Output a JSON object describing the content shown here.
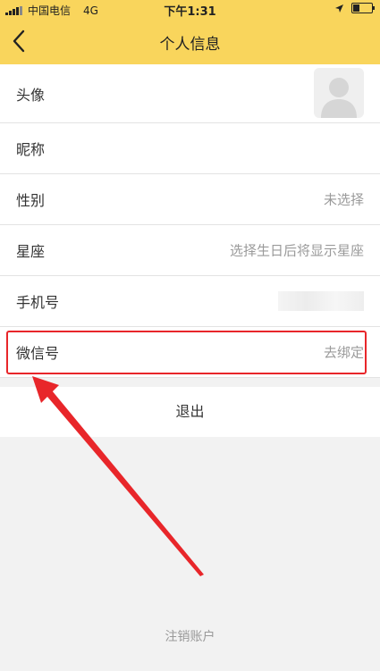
{
  "status_bar": {
    "carrier": "中国电信",
    "network": "4G",
    "time": "下午1:31",
    "battery_level": 0.35
  },
  "header": {
    "title": "个人信息"
  },
  "rows": [
    {
      "label": "头像",
      "value": ""
    },
    {
      "label": "昵称",
      "value": ""
    },
    {
      "label": "性别",
      "value": "未选择"
    },
    {
      "label": "星座",
      "value": "选择生日后将显示星座"
    },
    {
      "label": "手机号",
      "value": ""
    },
    {
      "label": "微信号",
      "value": "去绑定"
    }
  ],
  "logout_label": "退出",
  "deregister_label": "注销账户",
  "colors": {
    "header_bg": "#f9d55c",
    "annotation": "#e8262a"
  },
  "icons": [
    "signal-icon",
    "location-arrow-icon",
    "battery-icon",
    "back-chevron-icon",
    "avatar-placeholder-icon"
  ]
}
